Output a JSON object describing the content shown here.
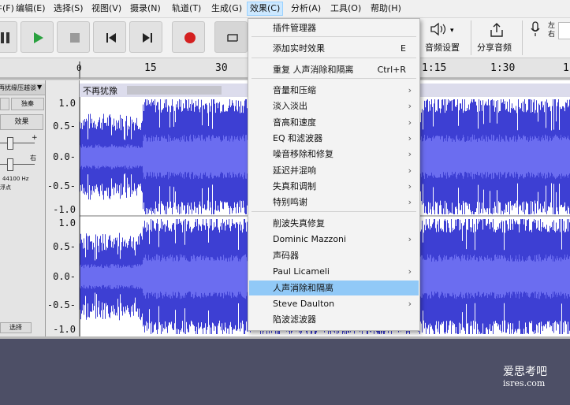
{
  "menubar": {
    "items": [
      {
        "label": "文件(F)"
      },
      {
        "label": "编辑(E)"
      },
      {
        "label": "选择(S)"
      },
      {
        "label": "视图(V)"
      },
      {
        "label": "摄录(N)"
      },
      {
        "label": "轨道(T)"
      },
      {
        "label": "生成(G)"
      },
      {
        "label": "效果(C)"
      },
      {
        "label": "分析(A)"
      },
      {
        "label": "工具(O)"
      },
      {
        "label": "帮助(H)"
      }
    ]
  },
  "toolbar": {
    "audio_setup_label": "音频设置",
    "share_audio_label": "分享音频",
    "channel_left": "左",
    "channel_right": "右",
    "colors": {
      "play": "#2aa13f",
      "record": "#d42020"
    }
  },
  "ruler": {
    "ticks": [
      "0",
      "15",
      "30",
      "1:15",
      "1:30",
      "1"
    ]
  },
  "track": {
    "name": "再扰缘压越谈",
    "clip_title": "不再犹豫",
    "mute_label": "独秦",
    "effects_label": "效果",
    "pan_right": "右",
    "rate": "44100 Hz",
    "format": "浮点",
    "select_label": "选择",
    "y_labels_top": [
      "1.0",
      "0.5-",
      "0.0-",
      "-0.5-",
      "-1.0"
    ],
    "y_labels_bottom": [
      "1.0",
      "0.5-",
      "0.0-",
      "-0.5-",
      "-1.0"
    ],
    "wave_color": "#3d3fd3"
  },
  "effects_menu": {
    "items": [
      {
        "label": "插件管理器",
        "shortcut": "",
        "submenu": false
      },
      {
        "label": "添加实时效果",
        "shortcut": "E",
        "submenu": false
      },
      {
        "label": "重复 人声消除和隔离",
        "shortcut": "Ctrl+R",
        "submenu": false
      },
      {
        "label": "音量和压缩",
        "shortcut": "",
        "submenu": true
      },
      {
        "label": "淡入淡出",
        "shortcut": "",
        "submenu": true
      },
      {
        "label": "音高和速度",
        "shortcut": "",
        "submenu": true
      },
      {
        "label": "EQ 和滤波器",
        "shortcut": "",
        "submenu": true
      },
      {
        "label": "噪音移除和修复",
        "shortcut": "",
        "submenu": true
      },
      {
        "label": "延迟并混响",
        "shortcut": "",
        "submenu": true
      },
      {
        "label": "失真和调制",
        "shortcut": "",
        "submenu": true
      },
      {
        "label": "特别鸣谢",
        "shortcut": "",
        "submenu": true
      },
      {
        "label": "削波失真修复",
        "shortcut": "",
        "submenu": false
      },
      {
        "label": "Dominic Mazzoni",
        "shortcut": "",
        "submenu": true
      },
      {
        "label": "声码器",
        "shortcut": "",
        "submenu": false
      },
      {
        "label": "Paul Licameli",
        "shortcut": "",
        "submenu": true
      },
      {
        "label": "人声消除和隔离",
        "shortcut": "",
        "submenu": false,
        "highlighted": true
      },
      {
        "label": "Steve Daulton",
        "shortcut": "",
        "submenu": true
      },
      {
        "label": "陷波滤波器",
        "shortcut": "",
        "submenu": false
      }
    ],
    "highlight_color": "#91c9f7"
  },
  "watermark": {
    "line1": "爱思考吧",
    "line2": "isres.com"
  }
}
